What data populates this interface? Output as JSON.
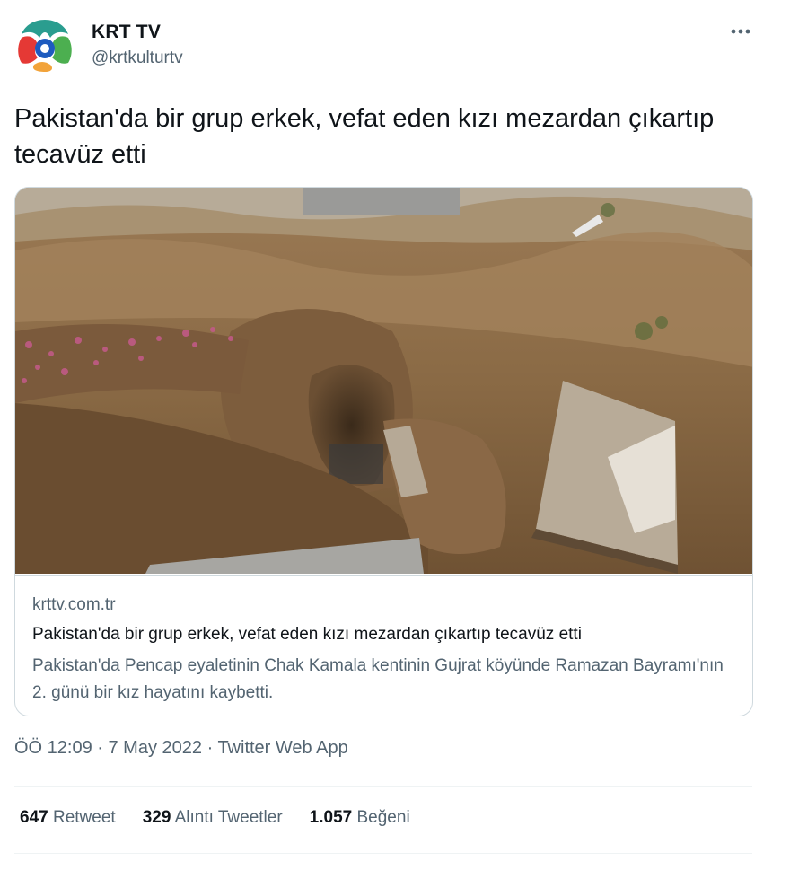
{
  "tweet": {
    "author": {
      "name": "KRT TV",
      "handle": "@krtkulturtv",
      "brand_colors": {
        "teal": "#2a9d8f",
        "green": "#4caf50",
        "red": "#e53935",
        "blue": "#1e5bbf"
      }
    },
    "text": "Pakistan'da bir grup erkek, vefat eden kızı mezardan çıkartıp tecavüz etti",
    "more_icon": "more-dots-icon",
    "card": {
      "image_alt": "dug-up grave with soil and broken slabs",
      "domain": "krttv.com.tr",
      "title": "Pakistan'da bir grup erkek, vefat eden kızı mezardan çıkartıp tecavüz etti",
      "description": "Pakistan'da Pencap eyaletinin Chak Kamala kentinin Gujrat köyünde Ramazan Bayramı'nın 2. günü bir kız hayatını kaybetti."
    },
    "meta": {
      "time": "ÖÖ 12:09",
      "separator": " · ",
      "date": "7 May 2022",
      "source": "Twitter Web App"
    },
    "stats": {
      "retweets": {
        "count": "647",
        "label": "Retweet"
      },
      "quotes": {
        "count": "329",
        "label": "Alıntı Tweetler"
      },
      "likes": {
        "count": "1.057",
        "label": "Beğeni"
      }
    }
  },
  "colors": {
    "text_primary": "#0f1419",
    "text_secondary": "#536471",
    "border": "#cfd9de"
  }
}
